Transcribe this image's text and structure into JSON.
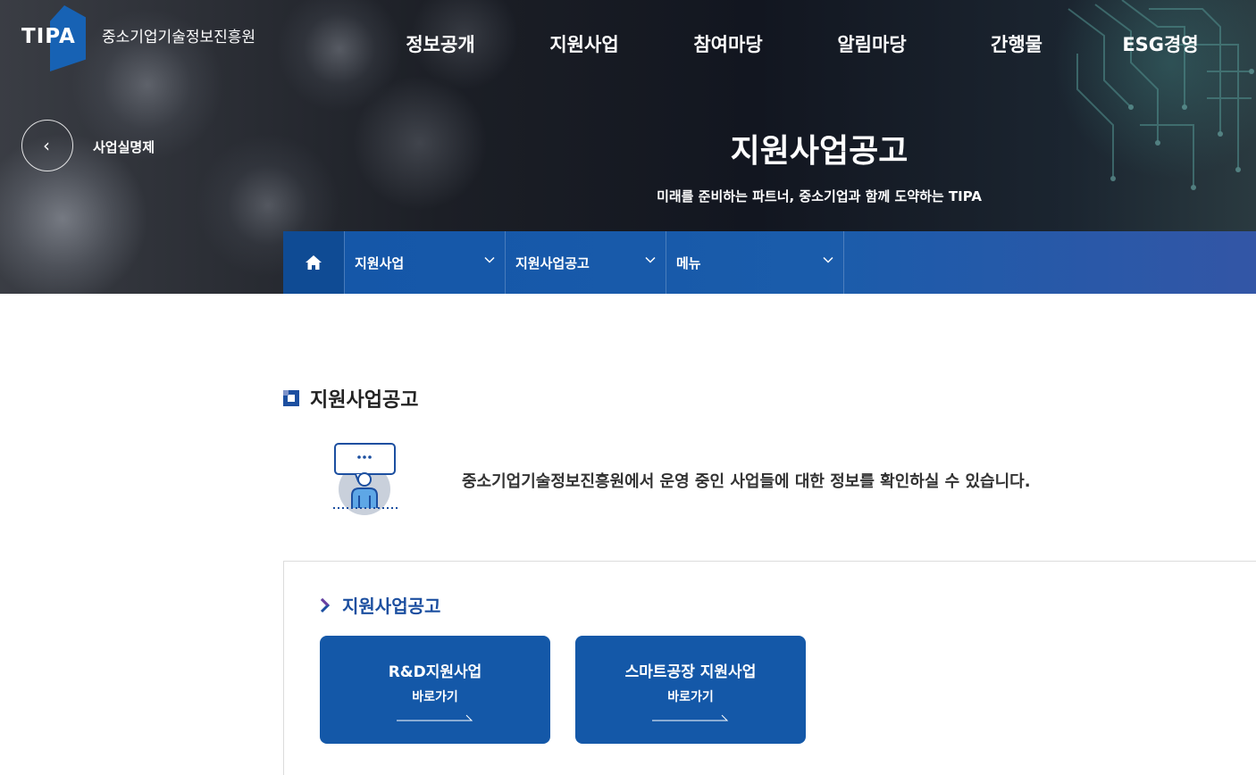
{
  "header": {
    "logo_mark": "TIPA",
    "logo_name": "중소기업기술정보진흥원",
    "nav": [
      "정보공개",
      "지원사업",
      "참여마당",
      "알림마당",
      "간행물",
      "ESG경영"
    ]
  },
  "hero": {
    "back_label": "사업실명제",
    "title": "지원사업공고",
    "subtitle": "미래를 준비하는 파트너, 중소기업과 함께 도약하는 TIPA"
  },
  "location": {
    "items": [
      "지원사업",
      "지원사업공고",
      "메뉴"
    ]
  },
  "content": {
    "section_title": "지원사업공고",
    "intro": "중소기업기술정보진흥원에서 운영 중인 사업들에 대한 정보를 확인하실 수 있습니다.",
    "sub_title": "지원사업공고",
    "cards": [
      {
        "title": "R&D지원사업",
        "go": "바로가기"
      },
      {
        "title": "스마트공장 지원사업",
        "go": "바로가기"
      }
    ]
  },
  "colors": {
    "brand_blue": "#1458a8",
    "nav_dark": "#0f4b94",
    "title_blue": "#1c4fa0"
  }
}
